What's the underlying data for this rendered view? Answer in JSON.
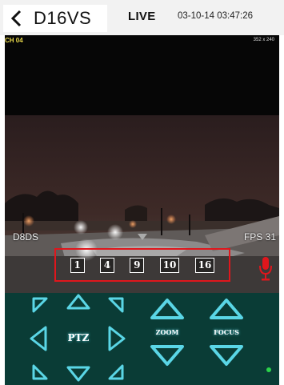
{
  "header": {
    "title": "D16VS",
    "mode": "LIVE",
    "datetime": "03-10-14 03:47:26"
  },
  "video": {
    "channel": "CH 04",
    "resolution": "352 x 240",
    "dvr_name": "D8DS",
    "fps": "FPS 31"
  },
  "split_buttons": [
    "1",
    "4",
    "9",
    "10",
    "16"
  ],
  "controls": {
    "ptz_label": "PTZ",
    "zoom_label": "ZOOM",
    "focus_label": "FOCUS"
  },
  "colors": {
    "accent": "#5ad6e6",
    "panel_bg": "#0a3c36",
    "highlight_border": "#e0161c",
    "mic": "#e0161c",
    "status": "#2bd34a"
  },
  "icons": [
    "back-chevron-icon",
    "mic-icon",
    "arrow-up-icon",
    "arrow-down-icon",
    "arrow-left-icon",
    "arrow-right-icon"
  ]
}
